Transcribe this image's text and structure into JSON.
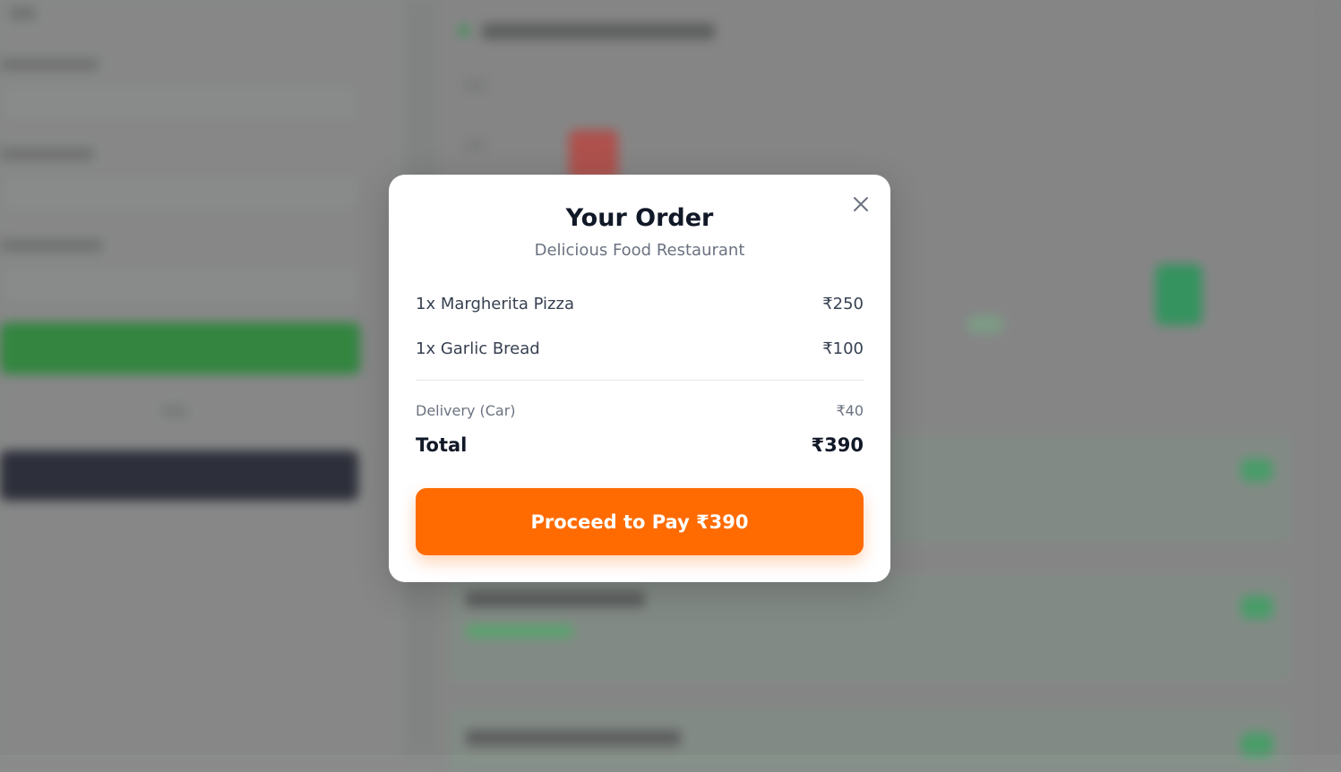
{
  "modal": {
    "title": "Your Order",
    "restaurant": "Delicious Food Restaurant",
    "items": [
      {
        "label": "1x Margherita Pizza",
        "price": "₹250"
      },
      {
        "label": "1x Garlic Bread",
        "price": "₹100"
      }
    ],
    "delivery": {
      "label": "Delivery (Car)",
      "price": "₹40"
    },
    "total": {
      "label": "Total",
      "price": "₹390"
    },
    "pay_button_label": "Proceed to Pay ₹390",
    "close_icon": "close-icon"
  },
  "colors": {
    "accent": "#ff6b00",
    "title": "#111827",
    "muted": "#6b7280"
  }
}
